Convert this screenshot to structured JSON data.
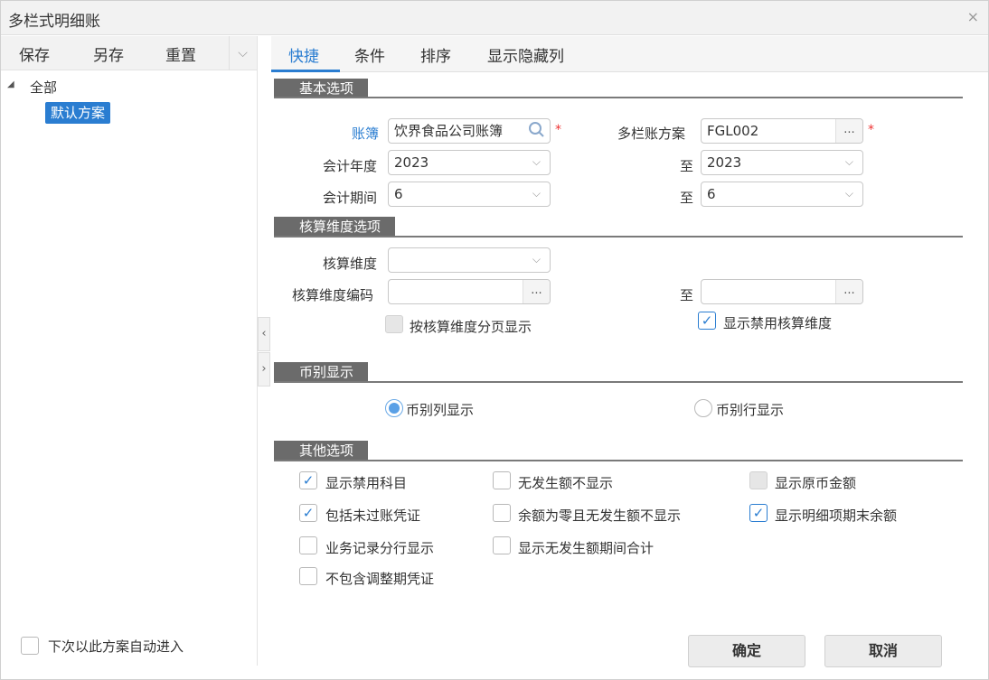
{
  "window": {
    "title": "多栏式明细账",
    "close_icon": "×"
  },
  "left": {
    "toolbar": {
      "save": "保存",
      "save_as": "另存",
      "reset": "重置",
      "dropdown_icon": "⌵"
    },
    "tree": {
      "toggle_icon": "◢",
      "root": "全部",
      "child": "默认方案"
    },
    "auto_enter_label": "下次以此方案自动进入",
    "auto_enter_checked": false
  },
  "collapse": {
    "left": "‹",
    "right": "›"
  },
  "tabs": [
    {
      "label": "快捷",
      "active": true
    },
    {
      "label": "条件",
      "active": false
    },
    {
      "label": "排序",
      "active": false
    },
    {
      "label": "显示隐藏列",
      "active": false
    }
  ],
  "basic": {
    "header": "基本选项",
    "book_label": "账簿",
    "book_value": "饮界食品公司账簿",
    "scheme_label": "多栏账方案",
    "scheme_value": "FGL002",
    "required_mark": "*",
    "year_label": "会计年度",
    "year_from": "2023",
    "to_label": "至",
    "year_to": "2023",
    "period_label": "会计期间",
    "period_from": "6",
    "period_to": "6"
  },
  "dimension": {
    "header": "核算维度选项",
    "dim_label": "核算维度",
    "dim_value": "",
    "code_label": "核算维度编码",
    "code_from": "",
    "to_label": "至",
    "code_to": "",
    "paginate_label": "按核算维度分页显示",
    "paginate_checked": false,
    "show_disabled_label": "显示禁用核算维度",
    "show_disabled_checked": true
  },
  "currency": {
    "header": "币别显示",
    "column_label": "币别列显示",
    "row_label": "币别行显示",
    "selected": "column"
  },
  "other": {
    "header": "其他选项",
    "options": [
      {
        "label": "显示禁用科目",
        "checked": true
      },
      {
        "label": "包括未过账凭证",
        "checked": true
      },
      {
        "label": "业务记录分行显示",
        "checked": false
      },
      {
        "label": "不包含调整期凭证",
        "checked": false
      },
      {
        "label": "无发生额不显示",
        "checked": false
      },
      {
        "label": "余额为零且无发生额不显示",
        "checked": false
      },
      {
        "label": "显示无发生额期间合计",
        "checked": false
      },
      {
        "label": "显示原币金额",
        "checked": false,
        "disabled": true
      },
      {
        "label": "显示明细项期末余额",
        "checked": true
      }
    ]
  },
  "icons": {
    "check": "✓",
    "search": "🔍",
    "chevron": "⌵",
    "ellipsis": "..."
  },
  "buttons": {
    "ok": "确定",
    "cancel": "取消"
  },
  "colors": {
    "accent": "#2a7dd1",
    "section_header": "#6b6b6b",
    "required": "#ee3333"
  }
}
